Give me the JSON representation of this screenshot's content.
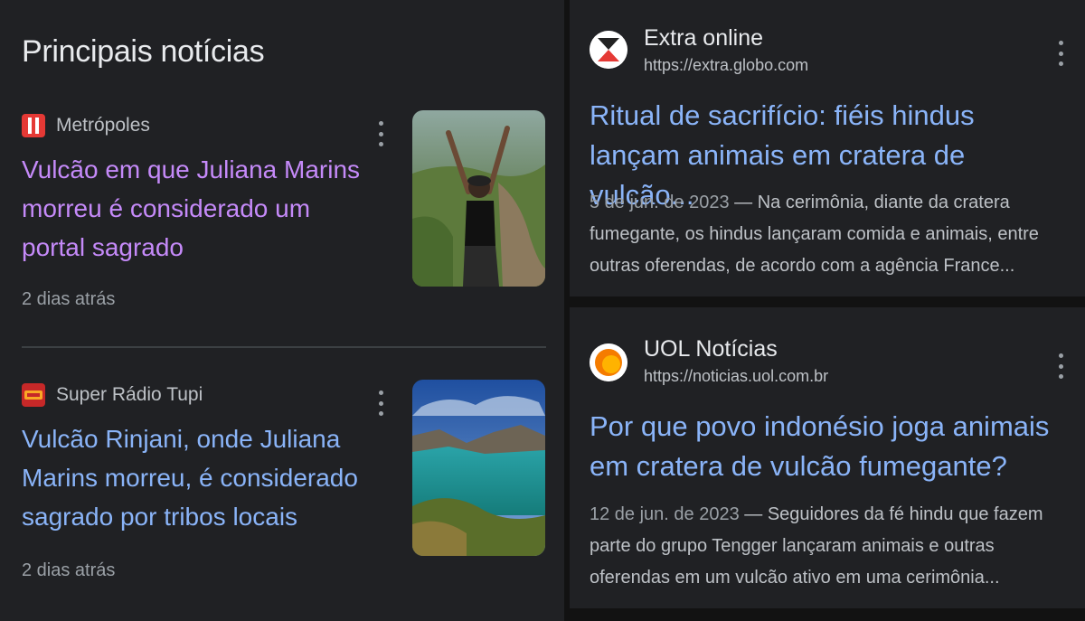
{
  "top_stories": {
    "title": "Principais notícias",
    "items": [
      {
        "source": "Metrópoles",
        "source_icon": "metropoles-logo",
        "headline": "Vulcão em que Juliana Marins morreu é considerado um portal sagrado",
        "age": "2 dias atrás",
        "thumbnail": "woman-arms-raised-photo",
        "visited": true
      },
      {
        "source": "Super Rádio Tupi",
        "source_icon": "tupi-logo",
        "headline": "Vulcão Rinjani, onde Juliana Marins morreu, é considerado sagrado por tribos locais",
        "age": "2 dias atrás",
        "thumbnail": "crater-lake-photo",
        "visited": false
      }
    ]
  },
  "results": [
    {
      "site_name": "Extra online",
      "url": "https://extra.globo.com",
      "title": "Ritual de sacrifício: fiéis hindus lançam animais em cratera de vulcão...",
      "date": "5 de jun. de 2023",
      "snippet": "Na cerimônia, diante da cratera fumegante, os hindus lançaram comida e animais, entre outras oferendas, de acordo com a agência France..."
    },
    {
      "site_name": "UOL Notícias",
      "url": "https://noticias.uol.com.br",
      "title": "Por que povo indonésio joga animais em cratera de vulcão fumegante?",
      "date": "12 de jun. de 2023",
      "snippet": "Seguidores da fé hindu que fazem parte do grupo Tengger lançaram animais e outras oferendas em um vulcão ativo em uma cerimônia..."
    }
  ],
  "separator": " — ",
  "colors": {
    "background": "#202124",
    "visited_link": "#c58af9",
    "link": "#8ab4f8",
    "secondary_text": "#bdc1c6"
  }
}
